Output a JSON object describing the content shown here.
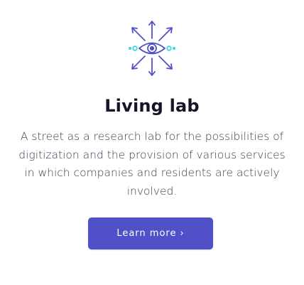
{
  "card": {
    "title": "Living lab",
    "description": "A street as a research lab for the possibilities of digitization and the provision of various services in which companies and residents are actively involved.",
    "cta_label": "Learn more",
    "cta_chevron": "›"
  },
  "colors": {
    "accent": "#5050c8",
    "icon_stroke": "#5050c8",
    "icon_secondary": "#42d6e4",
    "title": "#14142b",
    "body_text": "#3c3c50"
  },
  "icons": {
    "feature": "eye-with-arrows-icon"
  }
}
